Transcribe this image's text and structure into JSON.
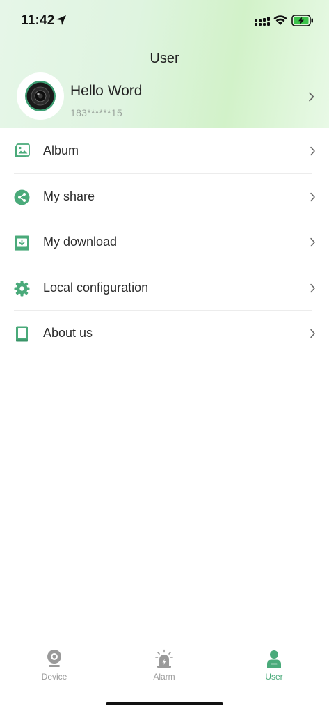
{
  "status_bar": {
    "time": "11:42",
    "icons": [
      "location-arrow-icon",
      "cellular-signal-icon",
      "wifi-icon",
      "battery-charging-icon"
    ]
  },
  "header": {
    "title": "User",
    "profile": {
      "name": "Hello Word",
      "phone": "183******15"
    }
  },
  "menu": {
    "items": [
      {
        "label": "Album",
        "icon": "album-icon"
      },
      {
        "label": "My share",
        "icon": "share-icon"
      },
      {
        "label": "My download",
        "icon": "download-icon"
      },
      {
        "label": "Local configuration",
        "icon": "gear-icon"
      },
      {
        "label": "About us",
        "icon": "book-icon"
      }
    ]
  },
  "tabbar": {
    "tabs": [
      {
        "label": "Device",
        "icon": "camera-icon",
        "active": false
      },
      {
        "label": "Alarm",
        "icon": "alarm-siren-icon",
        "active": false
      },
      {
        "label": "User",
        "icon": "user-icon",
        "active": true
      }
    ]
  },
  "colors": {
    "accent": "#4aaa7a",
    "inactive": "#9a9a9a",
    "header_gradient_start": "#e6f6e8",
    "header_gradient_end": "#d2f2c9"
  }
}
